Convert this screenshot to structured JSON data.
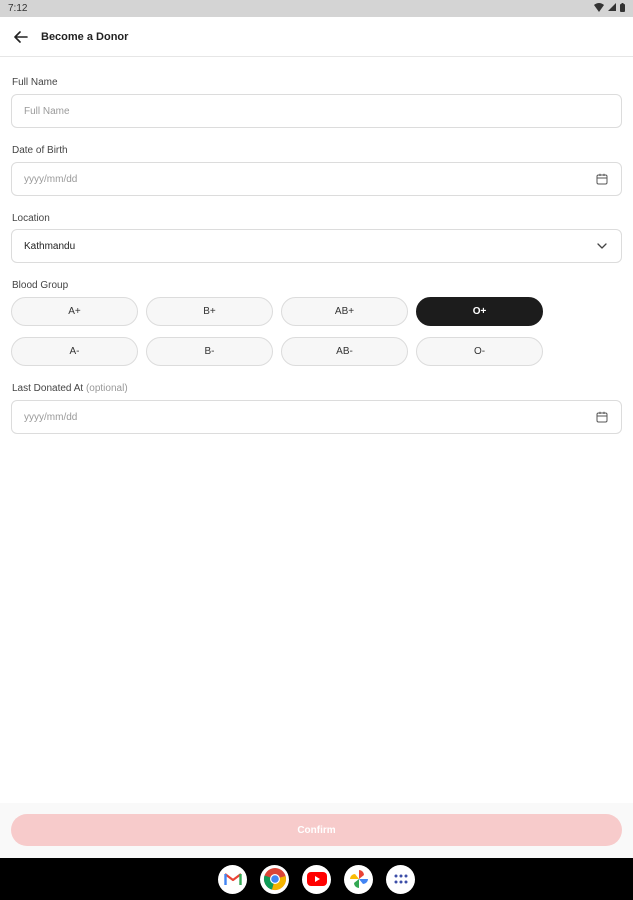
{
  "status_bar": {
    "time": "7:12"
  },
  "app_bar": {
    "title": "Become a Donor"
  },
  "form": {
    "full_name": {
      "label": "Full Name",
      "placeholder": "Full Name",
      "value": ""
    },
    "date_of_birth": {
      "label": "Date of Birth",
      "placeholder": "yyyy/mm/dd",
      "value": ""
    },
    "location": {
      "label": "Location",
      "value": "Kathmandu"
    },
    "blood_group": {
      "label": "Blood Group",
      "options": [
        "A+",
        "B+",
        "AB+",
        "O+",
        "A-",
        "B-",
        "AB-",
        "O-"
      ],
      "selected": "O+"
    },
    "last_donated": {
      "label": "Last Donated At",
      "optional_text": "(optional)",
      "placeholder": "yyyy/mm/dd",
      "value": ""
    }
  },
  "confirm_button": {
    "label": "Confirm"
  },
  "dock": {
    "apps": [
      "gmail-icon",
      "chrome-icon",
      "youtube-icon",
      "photos-icon",
      "app-drawer-icon"
    ]
  },
  "colors": {
    "selected_chip": "#1c1c1c",
    "confirm_disabled": "#f7cbcb",
    "status_bar": "#d4d4d4"
  }
}
